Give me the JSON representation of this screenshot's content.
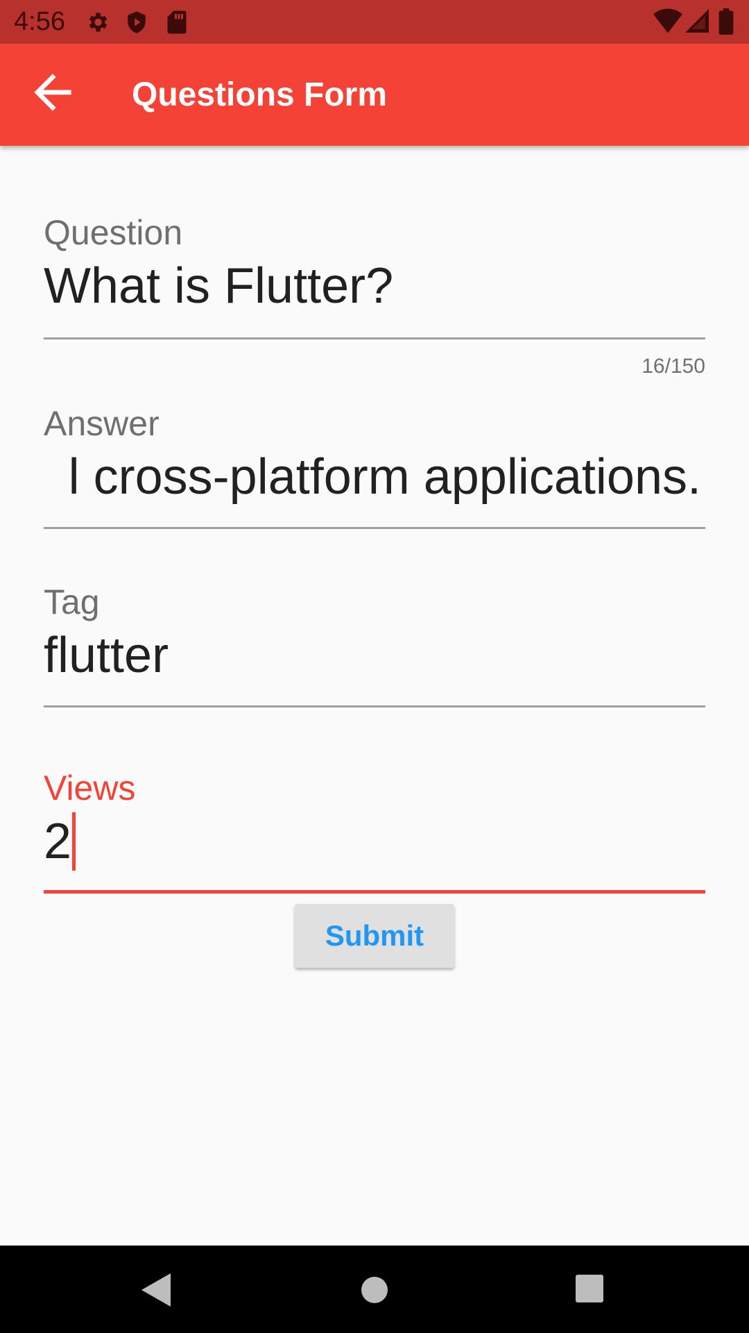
{
  "status_bar": {
    "time": "4:56",
    "icons_left": [
      "settings-icon",
      "shield-icon",
      "sd-card-icon"
    ],
    "icons_right": [
      "wifi-icon",
      "cellular-signal-icon",
      "battery-icon"
    ]
  },
  "app_bar": {
    "title": "Questions Form",
    "back_icon": "arrow-back-icon"
  },
  "form": {
    "question": {
      "label": "Question",
      "value": "What is Flutter?",
      "counter": "16/150"
    },
    "answer": {
      "label": "Answer",
      "value": "l cross-platform applications."
    },
    "tag": {
      "label": "Tag",
      "value": "flutter"
    },
    "views": {
      "label": "Views",
      "value": "2"
    },
    "submit_label": "Submit"
  },
  "nav_bar": {
    "icons": [
      "back-triangle-icon",
      "home-circle-icon",
      "recents-square-icon"
    ]
  },
  "colors": {
    "status_bar": "#b8312d",
    "app_bar": "#f44336",
    "accent": "#f44336",
    "button_text": "#2196f3",
    "background": "#fafafa"
  }
}
